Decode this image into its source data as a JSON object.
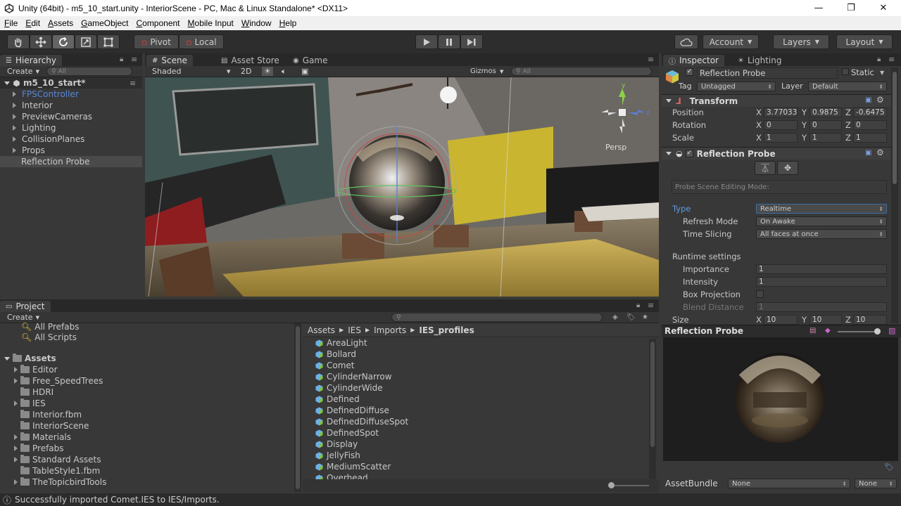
{
  "window": {
    "title": "Unity (64bit) - m5_10_start.unity - InteriorScene - PC, Mac & Linux Standalone* <DX11>",
    "minimize": "—",
    "maximize": "❐",
    "close": "✕"
  },
  "menu": [
    "File",
    "Edit",
    "Assets",
    "GameObject",
    "Component",
    "Mobile Input",
    "Window",
    "Help"
  ],
  "toolbar": {
    "pivot": "Pivot",
    "local": "Local",
    "account": "Account",
    "layers": "Layers",
    "layout": "Layout",
    "transform_tools": [
      "hand-tool",
      "move-tool",
      "rotate-tool",
      "scale-tool",
      "rect-tool"
    ],
    "play_controls": [
      "play",
      "pause",
      "step"
    ]
  },
  "hierarchy": {
    "tab": "Hierarchy",
    "create": "Create",
    "search_placeholder": "All",
    "scene": "m5_10_start*",
    "items": [
      {
        "label": "FPSController",
        "color": "#5a86d8"
      },
      {
        "label": "Interior"
      },
      {
        "label": "PreviewCameras"
      },
      {
        "label": "Lighting"
      },
      {
        "label": "CollisionPlanes"
      },
      {
        "label": "Props"
      },
      {
        "label": "Reflection Probe",
        "selected": true
      }
    ]
  },
  "sceneview": {
    "tabs": [
      "Scene",
      "Asset Store",
      "Game"
    ],
    "shading": "Shaded",
    "mode_2d": "2D",
    "gizmos": "Gizmos",
    "search_placeholder": "All",
    "persp": "Persp"
  },
  "inspector": {
    "tabs": [
      "Inspector",
      "Lighting"
    ],
    "object_name": "Reflection Probe",
    "static": "Static",
    "tag_label": "Tag",
    "tag_value": "Untagged",
    "layer_label": "Layer",
    "layer_value": "Default",
    "transform": {
      "title": "Transform",
      "position": {
        "label": "Position",
        "x": "3.77033",
        "y": "0.9875",
        "z": "-0.6475"
      },
      "rotation": {
        "label": "Rotation",
        "x": "0",
        "y": "0",
        "z": "0"
      },
      "scale": {
        "label": "Scale",
        "x": "1",
        "y": "1",
        "z": "1"
      }
    },
    "probe": {
      "title": "Reflection Probe",
      "editing_mode": "Probe Scene Editing Mode:",
      "type_label": "Type",
      "type_value": "Realtime",
      "refresh_label": "Refresh Mode",
      "refresh_value": "On Awake",
      "slicing_label": "Time Slicing",
      "slicing_value": "All faces at once",
      "runtime_label": "Runtime settings",
      "importance_label": "Importance",
      "importance_value": "1",
      "intensity_label": "Intensity",
      "intensity_value": "1",
      "box_projection_label": "Box Projection",
      "blend_label": "Blend Distance",
      "blend_value": "1",
      "size_label": "Size",
      "size_x": "10",
      "size_y": "10",
      "size_z": "10"
    },
    "preview_title": "Reflection Probe",
    "assetbundle_label": "AssetBundle",
    "assetbundle_value": "None",
    "assetbundle_variant": "None"
  },
  "project": {
    "tab": "Project",
    "create": "Create",
    "favorites": [
      "All Prefabs",
      "All Scripts"
    ],
    "assets_label": "Assets",
    "folders": [
      {
        "label": "Editor",
        "arrow": true
      },
      {
        "label": "Free_SpeedTrees",
        "arrow": true
      },
      {
        "label": "HDRI",
        "arrow": false
      },
      {
        "label": "IES",
        "arrow": true
      },
      {
        "label": "Interior.fbm",
        "arrow": false
      },
      {
        "label": "InteriorScene",
        "arrow": false
      },
      {
        "label": "Materials",
        "arrow": true
      },
      {
        "label": "Prefabs",
        "arrow": true
      },
      {
        "label": "Standard Assets",
        "arrow": true
      },
      {
        "label": "TableStyle1.fbm",
        "arrow": false
      },
      {
        "label": "TheTopicbirdTools",
        "arrow": true
      }
    ],
    "breadcrumb": [
      "Assets",
      "IES",
      "Imports",
      "IES_profiles"
    ],
    "files": [
      "AreaLight",
      "Bollard",
      "Comet",
      "CylinderNarrow",
      "CylinderWide",
      "Defined",
      "DefinedDiffuse",
      "DefinedDiffuseSpot",
      "DefinedSpot",
      "Display",
      "JellyFish",
      "MediumScatter",
      "Overhead"
    ]
  },
  "status": "Successfully imported Comet.IES to IES/Imports."
}
